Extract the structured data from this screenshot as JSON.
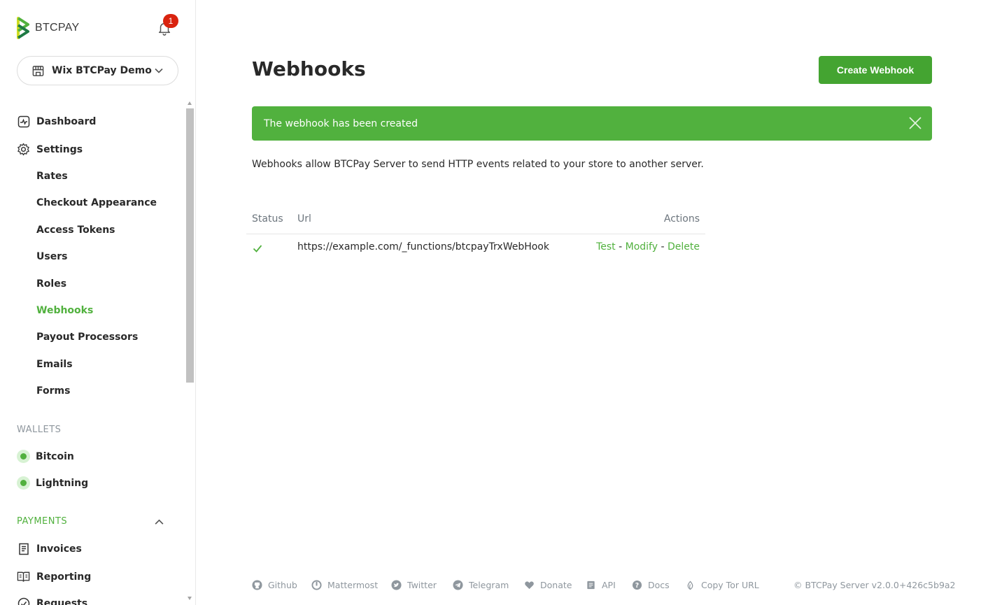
{
  "brand": {
    "name": "BTCPAY"
  },
  "notifications": {
    "count": "1"
  },
  "store_selector": {
    "label": "Wix BTCPay Demo"
  },
  "nav": {
    "dashboard": "Dashboard",
    "settings": "Settings",
    "settings_sub": [
      "Rates",
      "Checkout Appearance",
      "Access Tokens",
      "Users",
      "Roles",
      "Webhooks",
      "Payout Processors",
      "Emails",
      "Forms"
    ],
    "active_sub": "Webhooks",
    "wallets_header": "WALLETS",
    "wallets": [
      "Bitcoin",
      "Lightning"
    ],
    "payments_header": "PAYMENTS",
    "payments": [
      "Invoices",
      "Reporting",
      "Requests"
    ]
  },
  "main": {
    "title": "Webhooks",
    "create_button": "Create Webhook",
    "alert": "The webhook has been created",
    "description": "Webhooks allow BTCPay Server to send HTTP events related to your store to another server.",
    "table": {
      "headers": {
        "status": "Status",
        "url": "Url",
        "actions": "Actions"
      },
      "rows": [
        {
          "url": "https://example.com/_functions/btcpayTrxWebHook",
          "actions": [
            "Test",
            "Modify",
            "Delete"
          ],
          "separator": "-"
        }
      ]
    }
  },
  "footer": {
    "links": [
      "Github",
      "Mattermost",
      "Twitter",
      "Telegram",
      "Donate",
      "API",
      "Docs",
      "Copy Tor URL"
    ],
    "copyright": "© BTCPay Server v2.0.0+426c5b9a2"
  },
  "colors": {
    "accent": "#51b13e",
    "button": "#44a431",
    "badge": "#d9230f"
  }
}
